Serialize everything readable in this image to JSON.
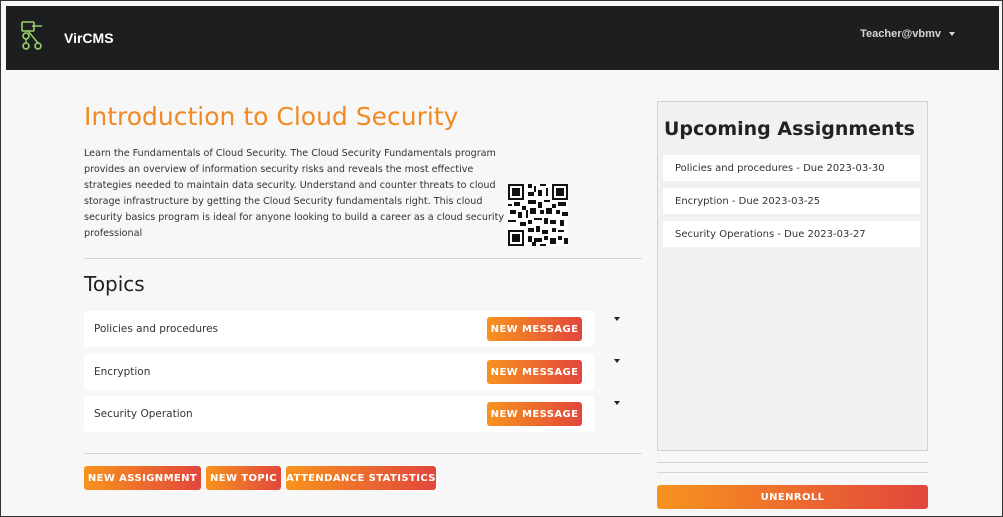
{
  "navbar": {
    "brand": "VirCMS",
    "user": "Teacher@vbmv"
  },
  "course": {
    "title": "Introduction to Cloud Security",
    "description": "Learn the Fundamentals of Cloud Security. The Cloud Security Fundamentals program provides an overview of information security risks and reveals the most effective strategies needed to maintain data security. Understand and counter threats to cloud storage infrastructure by getting the Cloud Security fundamentals right. This cloud security basics program is ideal for anyone looking to build a career as a cloud security professional"
  },
  "topics": {
    "heading": "Topics",
    "items": [
      {
        "label": "Policies and procedures",
        "button": "NEW MESSAGE"
      },
      {
        "label": "Encryption",
        "button": "NEW MESSAGE"
      },
      {
        "label": "Security Operation",
        "button": "NEW MESSAGE"
      }
    ]
  },
  "actions": {
    "new_assignment": "NEW ASSIGNMENT",
    "new_topic": "NEW TOPIC",
    "attendance": "ATTENDANCE STATISTICS"
  },
  "assignments": {
    "heading": "Upcoming Assignments",
    "items": [
      "Policies and procedures - Due 2023-03-30",
      "Encryption - Due 2023-03-25",
      "Security Operations - Due 2023-03-27"
    ]
  },
  "unenroll": "UNENROLL",
  "colors": {
    "accent": "#f08a24",
    "gradient_start": "#f7931e",
    "gradient_end": "#e2463d",
    "navbar": "#1d1e1f"
  },
  "icons": {
    "logo": "network-nodes-icon",
    "qr": "qr-code"
  }
}
